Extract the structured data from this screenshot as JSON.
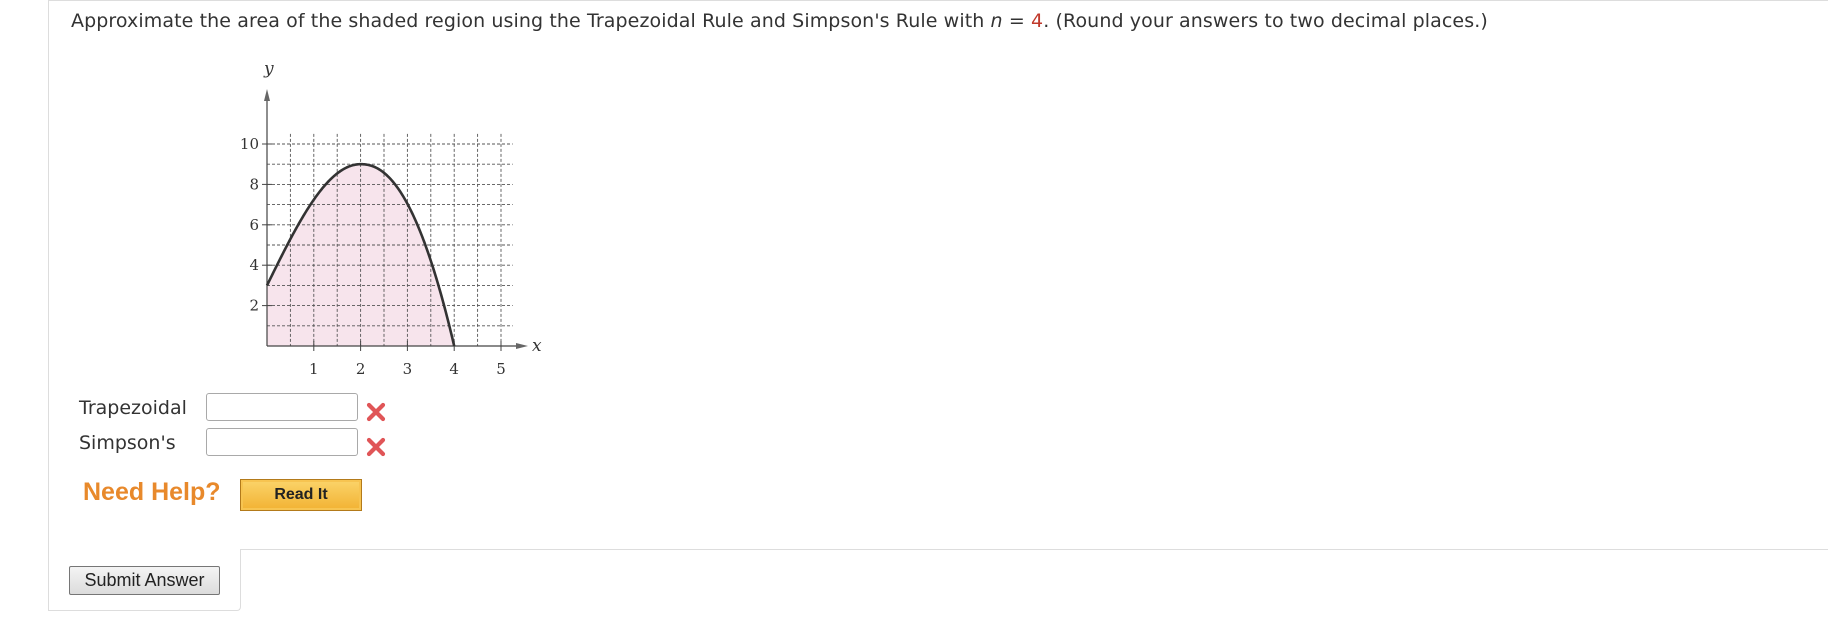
{
  "question": {
    "text_before": "Approximate the area of the shaded region using the Trapezoidal Rule and Simpson's Rule with ",
    "var": "n",
    "eq": " = ",
    "n_value": "4",
    "text_after": ". (Round your answers to two decimal places.)"
  },
  "graph": {
    "y_axis_label": "y",
    "x_axis_label": "x",
    "y_ticks": [
      "10",
      "8",
      "6",
      "4",
      "2"
    ],
    "x_ticks": [
      "1",
      "2",
      "3",
      "4",
      "5"
    ]
  },
  "answers": [
    {
      "label": "Trapezoidal",
      "value": "",
      "status": "incorrect"
    },
    {
      "label": "Simpson's",
      "value": "",
      "status": "incorrect"
    }
  ],
  "help": {
    "label": "Need Help?",
    "read_it": "Read It"
  },
  "submit_label": "Submit Answer",
  "colors": {
    "accent_orange": "#e8892b",
    "error_red": "#e05557",
    "shade_fill": "#f7e4ec",
    "value_red": "#c0392b"
  },
  "icons": [
    "close-x-icon"
  ]
}
